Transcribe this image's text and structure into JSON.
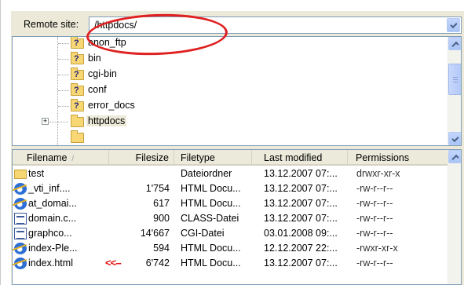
{
  "remote_site": {
    "label": "Remote site:",
    "path": "/httpdocs/"
  },
  "tree": {
    "items": [
      {
        "label": "anon_ftp",
        "icon": "folder-question-icon"
      },
      {
        "label": "bin",
        "icon": "folder-question-icon"
      },
      {
        "label": "cgi-bin",
        "icon": "folder-question-icon"
      },
      {
        "label": "conf",
        "icon": "folder-question-icon"
      },
      {
        "label": "error_docs",
        "icon": "folder-question-icon"
      },
      {
        "label": "httpdocs",
        "icon": "folder-icon",
        "expander": "+"
      }
    ]
  },
  "file_list": {
    "columns": [
      "Filename",
      "Filesize",
      "Filetype",
      "Last modified",
      "Permissions"
    ],
    "sort_arrow": "/",
    "rows": [
      {
        "name": "test",
        "size": "",
        "type": "Dateiordner",
        "modified": "13.12.2007 07:...",
        "perms": "drwxr-xr-x",
        "icon": "folder-icon"
      },
      {
        "name": "_vti_inf....",
        "size": "1'754",
        "type": "HTML Docu...",
        "modified": "13.12.2007 07:...",
        "perms": "-rw-r--r--",
        "icon": "ie-document-icon"
      },
      {
        "name": "at_domai...",
        "size": "617",
        "type": "HTML Docu...",
        "modified": "13.12.2007 07:...",
        "perms": "-rw-r--r--",
        "icon": "ie-document-icon"
      },
      {
        "name": "domain.c...",
        "size": "900",
        "type": "CLASS-Datei",
        "modified": "13.12.2007 07:...",
        "perms": "-rw-r--r--",
        "icon": "class-file-icon"
      },
      {
        "name": "graphco...",
        "size": "14'667",
        "type": "CGI-Datei",
        "modified": "03.01.2008 09:...",
        "perms": "-rw-r--r--",
        "icon": "cgi-file-icon"
      },
      {
        "name": "index-Ple...",
        "size": "594",
        "type": "HTML Docu...",
        "modified": "12.12.2007 22:...",
        "perms": "-rwxr-xr-x",
        "icon": "ie-document-icon"
      },
      {
        "name": "index.html",
        "size": "6'742",
        "type": "HTML Docu...",
        "modified": "13.12.2007 07:...",
        "perms": "-rw-r--r--",
        "icon": "ie-document-icon",
        "note": "<<--"
      }
    ]
  },
  "colors": {
    "annotation_red": "#e02020",
    "panel_bg": "#ece9d8",
    "scroll_blue": "#b3c9f7"
  }
}
